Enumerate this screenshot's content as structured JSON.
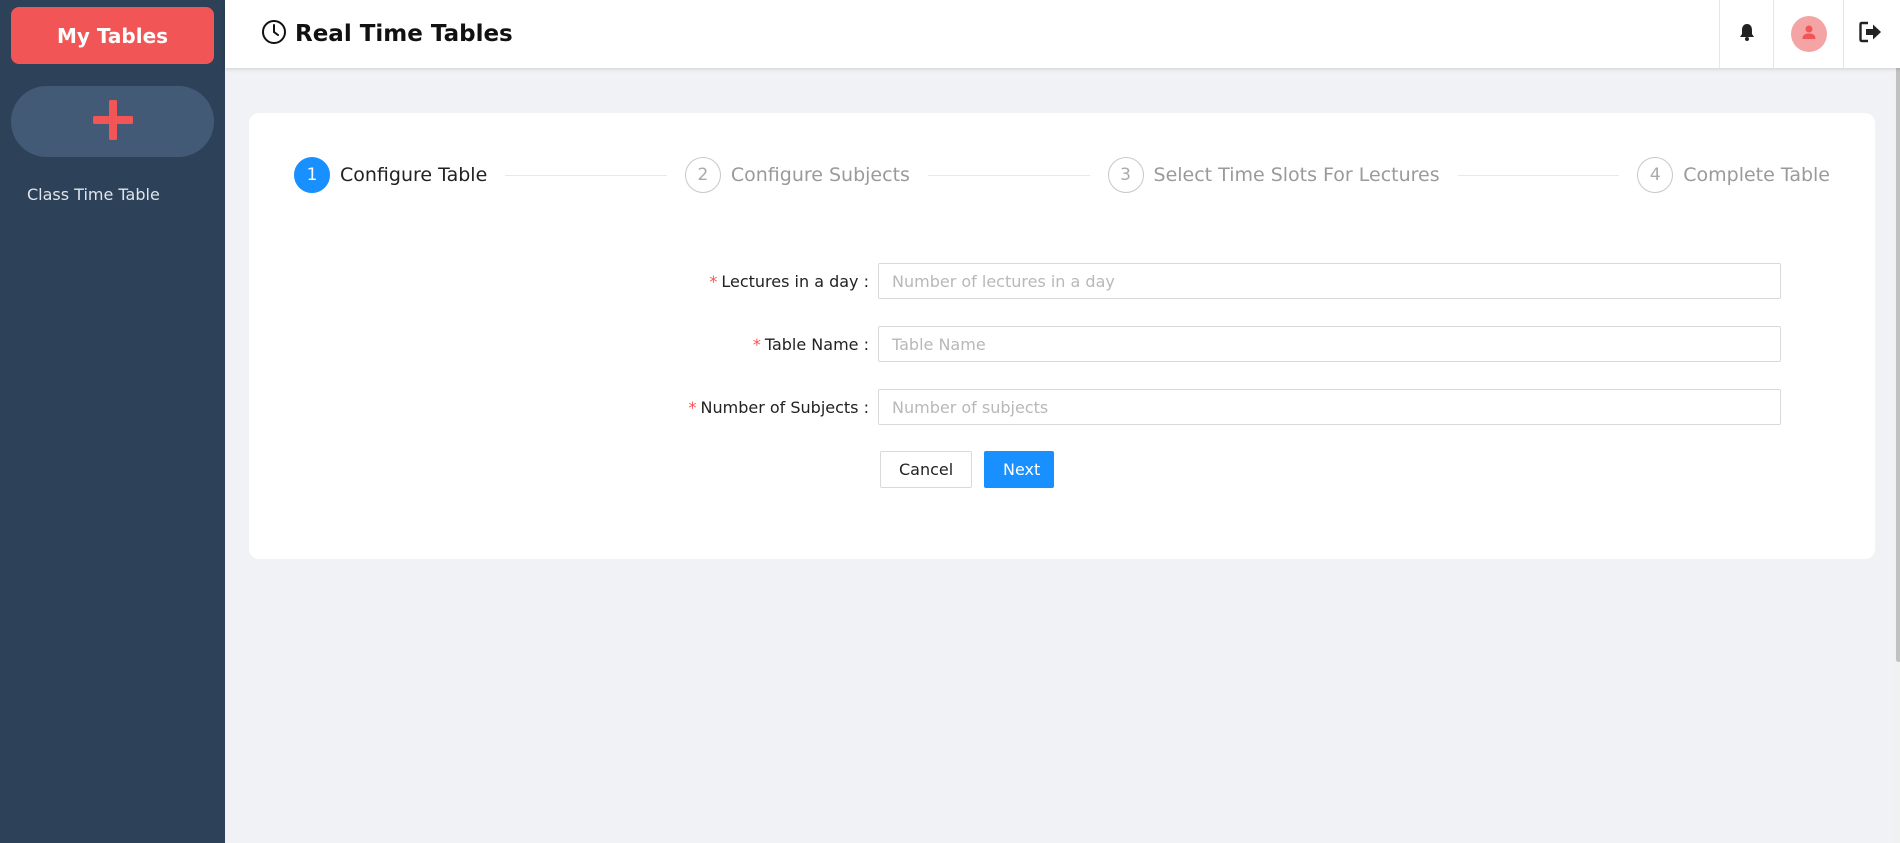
{
  "sidebar": {
    "my_tables_label": "My Tables",
    "add_icon": "plus-icon",
    "items": [
      {
        "label": "Class Time Table"
      }
    ]
  },
  "header": {
    "title": "Real Time Tables",
    "logo_icon": "clock-icon",
    "actions": [
      "bell-icon",
      "user-icon",
      "logout-icon"
    ]
  },
  "steps": [
    {
      "number": "1",
      "title": "Configure Table",
      "active": true
    },
    {
      "number": "2",
      "title": "Configure Subjects",
      "active": false
    },
    {
      "number": "3",
      "title": "Select Time Slots For Lectures",
      "active": false
    },
    {
      "number": "4",
      "title": "Complete Table",
      "active": false
    }
  ],
  "form": {
    "fields": [
      {
        "label": "Lectures in a day",
        "placeholder": "Number of lectures in a day",
        "value": ""
      },
      {
        "label": "Table Name",
        "placeholder": "Table Name",
        "value": ""
      },
      {
        "label": "Number of Subjects",
        "placeholder": "Number of subjects",
        "value": ""
      }
    ],
    "cancel_label": "Cancel",
    "next_label": "Next"
  },
  "colors": {
    "sidebar_bg": "#2d4159",
    "brand_red": "#f25555",
    "primary_blue": "#1890ff",
    "required_red": "#ff4d4f"
  }
}
